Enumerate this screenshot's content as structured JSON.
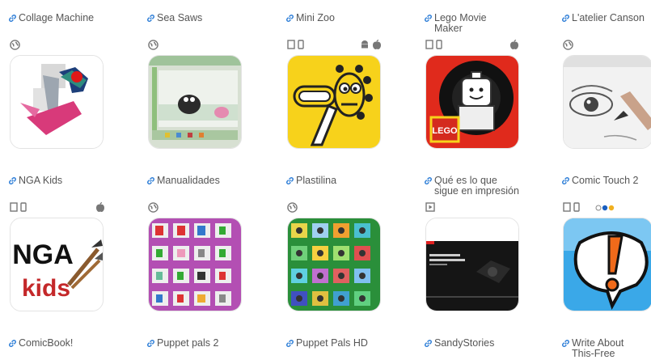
{
  "apps": [
    {
      "title": "Collage Machine",
      "platforms": [
        "web"
      ],
      "icon": "collage-machine-icon"
    },
    {
      "title": "Sea Saws",
      "platforms": [
        "web"
      ],
      "icon": "sea-saws-icon"
    },
    {
      "title": "Mini Zoo",
      "platforms": [
        "tablet",
        "phone",
        "android",
        "apple"
      ],
      "icon": "mini-zoo-icon"
    },
    {
      "title": "Lego Movie\nMaker",
      "platforms": [
        "tablet",
        "phone",
        "apple"
      ],
      "icon": "lego-movie-maker-icon",
      "icon_text": "LEGO"
    },
    {
      "title": "L'atelier Canson",
      "platforms": [
        "web"
      ],
      "icon": "latelier-canson-icon"
    },
    {
      "title": "NGA Kids",
      "platforms": [
        "tablet",
        "phone",
        "apple"
      ],
      "icon": "nga-kids-icon",
      "icon_text_1": "NGA",
      "icon_text_2": "kids"
    },
    {
      "title": "Manualidades",
      "platforms": [
        "web"
      ],
      "icon": "manualidades-icon"
    },
    {
      "title": "Plastilina",
      "platforms": [
        "web"
      ],
      "icon": "plastilina-icon"
    },
    {
      "title": "Qué es lo que\nsigue en impresión",
      "platforms": [
        "video"
      ],
      "icon": "que-es-lo-que-sigue-icon"
    },
    {
      "title": "Comic Touch 2",
      "platforms": [
        "tablet",
        "phone",
        "flickr"
      ],
      "icon": "comic-touch-icon"
    },
    {
      "title": "ComicBook!",
      "platforms": [],
      "icon": ""
    },
    {
      "title": "Puppet pals 2",
      "platforms": [],
      "icon": ""
    },
    {
      "title": "Puppet Pals HD",
      "platforms": [],
      "icon": ""
    },
    {
      "title": "SandyStories",
      "platforms": [],
      "icon": ""
    },
    {
      "title": "Write About\nThis-Free",
      "platforms": [],
      "icon": ""
    }
  ],
  "colors": {
    "link_blue": "#2f7fd8",
    "lego_red": "#d42a1e",
    "zoo_yellow": "#f7d21b",
    "comic_blue": "#39a7e6"
  }
}
